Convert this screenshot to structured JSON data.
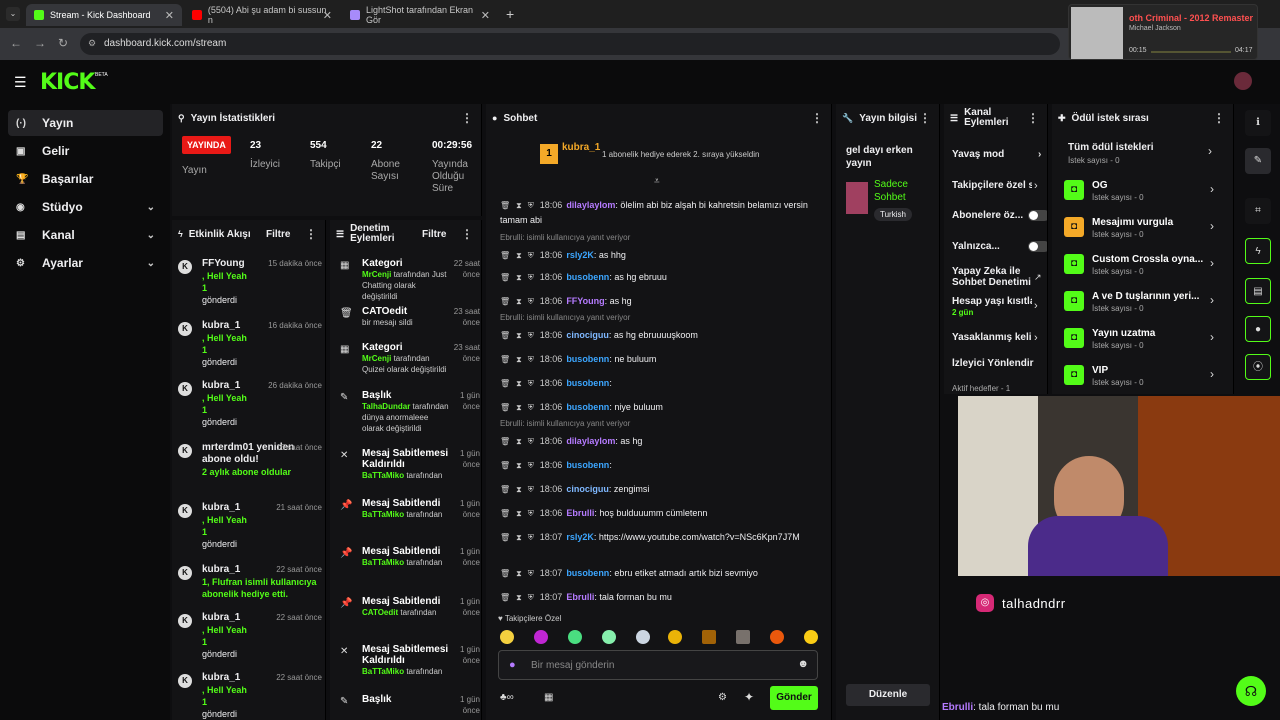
{
  "browser": {
    "tabs": [
      {
        "label": "Stream - Kick Dashboard",
        "color": "#53fc18"
      },
      {
        "label": "(5504) Abi şu adam bi sussun n",
        "color": "#ff0000"
      },
      {
        "label": "LightShot tarafından Ekran Gör",
        "color": "#a78bfa"
      }
    ],
    "url": "dashboard.kick.com/stream",
    "music": {
      "title": "oth Criminal - 2012 Remaster",
      "artist": "Michael Jackson",
      "elapsed": "00:15",
      "total": "04:17"
    }
  },
  "brand": {
    "logo": "KICK",
    "beta": "BETA",
    "accent": "#53fc18"
  },
  "sidebar": {
    "items": [
      {
        "label": "Yayın",
        "icon": "broadcast-icon",
        "glyph": "(·)"
      },
      {
        "label": "Gelir",
        "icon": "wallet-icon",
        "glyph": "▣"
      },
      {
        "label": "Başarılar",
        "icon": "trophy-icon",
        "glyph": "🏆"
      },
      {
        "label": "Stüdyo",
        "icon": "studio-icon",
        "glyph": "◉"
      },
      {
        "label": "Kanal",
        "icon": "channel-icon",
        "glyph": "▤"
      },
      {
        "label": "Ayarlar",
        "icon": "settings-icon",
        "glyph": "⚙"
      }
    ]
  },
  "stats": {
    "title": "Yayın İstatistikleri",
    "live": "YAYINDA",
    "live_label": "Yayın",
    "viewers": "23",
    "viewers_label": "İzleyici",
    "followers": "554",
    "followers_label": "Takipçi",
    "subs": "22",
    "subs_label": "Abone Sayısı",
    "uptime": "00:29:56",
    "uptime_label": "Yayında Olduğu Süre"
  },
  "activity": {
    "title": "Etkinlik Akışı",
    "filter": "Filtre",
    "events": [
      {
        "name": "FFYoung",
        "line2": ", Hell Yeah",
        "line3": "1",
        "line4": "gönderdi",
        "time": "15 dakika önce"
      },
      {
        "name": "kubra_1",
        "line2": ", Hell Yeah",
        "line3": "1",
        "line4": "gönderdi",
        "time": "16 dakika önce"
      },
      {
        "name": "kubra_1",
        "line2": ", Hell Yeah",
        "line3": "1",
        "line4": "gönderdi",
        "time": "26 dakika önce"
      },
      {
        "name": "mrterdm01 yeniden abone oldu!",
        "line2": "2 aylık abone oldular",
        "line3": "",
        "line4": "",
        "time": "15 saat önce"
      },
      {
        "name": "kubra_1",
        "line2": ", Hell Yeah",
        "line3": "1",
        "line4": "gönderdi",
        "time": "21 saat önce"
      },
      {
        "name": "kubra_1",
        "line2": "1, Flufran isimli kullanıcıya abonelik hediye etti.",
        "line3": "",
        "line4": "",
        "time": "22 saat önce"
      },
      {
        "name": "kubra_1",
        "line2": ", Hell Yeah",
        "line3": "1",
        "line4": "gönderdi",
        "time": "22 saat önce"
      },
      {
        "name": "kubra_1",
        "line2": ", Hell Yeah",
        "line3": "1",
        "line4": "gönderdi",
        "time": "22 saat önce"
      }
    ]
  },
  "moderation": {
    "title": "Denetim Eylemleri",
    "filter": "Filtre",
    "items": [
      {
        "title": "Kategori",
        "who": "MrCenji",
        "text": "tarafından Just Chatting olarak değiştirildi",
        "time": "22 saat önce",
        "glyph": "▦"
      },
      {
        "title": "CATOedit",
        "who": "",
        "text": "bir mesajı sildi",
        "time": "23 saat önce",
        "glyph": "🗑"
      },
      {
        "title": "Kategori",
        "who": "MrCenji",
        "text": "tarafından Quizei olarak değiştirildi",
        "time": "23 saat önce",
        "glyph": "▦"
      },
      {
        "title": "Başlık",
        "who": "TalhaDundar",
        "text": "tarafından dünya anormaleee olarak değiştirildi",
        "time": "1 gün önce",
        "glyph": "✎"
      },
      {
        "title": "Mesaj Sabitlemesi Kaldırıldı",
        "who": "BaTTaMiko",
        "text": "tarafından",
        "time": "1 gün önce",
        "glyph": "✕"
      },
      {
        "title": "Mesaj Sabitlendi",
        "who": "BaTTaMiko",
        "text": "tarafından",
        "time": "1 gün önce",
        "glyph": "📌"
      },
      {
        "title": "Mesaj Sabitlendi",
        "who": "BaTTaMiko",
        "text": "tarafından",
        "time": "1 gün önce",
        "glyph": "📌"
      },
      {
        "title": "Mesaj Sabitlendi",
        "who": "CATOedit",
        "text": "tarafından",
        "time": "1 gün önce",
        "glyph": "📌"
      },
      {
        "title": "Mesaj Sabitlemesi Kaldırıldı",
        "who": "BaTTaMiko",
        "text": "tarafından",
        "time": "1 gün önce",
        "glyph": "✕"
      },
      {
        "title": "Başlık",
        "who": "",
        "text": "",
        "time": "1 gün önce",
        "glyph": "✎"
      }
    ]
  },
  "chat": {
    "title": "Sohbet",
    "pinned_user": "kubra_1",
    "pinned_count": "1",
    "pinned_text": "1 abonelik hediye ederek 2. sıraya yükseldin",
    "lines": [
      {
        "time": "18:06",
        "user": "dilaylaylom",
        "color": "#b57bff",
        "text": ": ölelim abi biz alşah bi kahretsin belamızı versin tamam abi",
        "reply": ""
      },
      {
        "time": "18:06",
        "user": "rsly2K",
        "color": "#3ca6ff",
        "text": ": as hhg",
        "reply": "Ebrulli: isimli kullanıcıya yanıt veriyor"
      },
      {
        "time": "18:06",
        "user": "busobenn",
        "color": "#3ca6ff",
        "text": ": as hg ebruuu",
        "reply": ""
      },
      {
        "time": "18:06",
        "user": "FFYoung",
        "color": "#b57bff",
        "text": ": as hg",
        "reply": ""
      },
      {
        "time": "18:06",
        "user": "cinociguu",
        "color": "#7fb8ff",
        "text": ": as hg ebruuuuşkoom",
        "reply": "Ebrulli: isimli kullanıcıya yanıt veriyor"
      },
      {
        "time": "18:06",
        "user": "busobenn",
        "color": "#3ca6ff",
        "text": ": ne buluum",
        "reply": ""
      },
      {
        "time": "18:06",
        "user": "busobenn",
        "color": "#3ca6ff",
        "text": ":",
        "reply": ""
      },
      {
        "time": "18:06",
        "user": "busobenn",
        "color": "#3ca6ff",
        "text": ": niye buluum",
        "reply": ""
      },
      {
        "time": "18:06",
        "user": "dilaylaylom",
        "color": "#b57bff",
        "text": ": as hg",
        "reply": "Ebrulli: isimli kullanıcıya yanıt veriyor"
      },
      {
        "time": "18:06",
        "user": "busobenn",
        "color": "#3ca6ff",
        "text": ":",
        "reply": ""
      },
      {
        "time": "18:06",
        "user": "cinociguu",
        "color": "#7fb8ff",
        "text": ": zengimsi",
        "reply": ""
      },
      {
        "time": "18:06",
        "user": "Ebrulli",
        "color": "#b57bff",
        "text": ": hoş bulduuumm cümletenn",
        "reply": ""
      },
      {
        "time": "18:07",
        "user": "rsly2K",
        "color": "#3ca6ff",
        "text": ": https://www.youtube.com/watch?v=NSc6Kpn7J7M",
        "reply": ""
      },
      {
        "time": "18:07",
        "user": "busobenn",
        "color": "#3ca6ff",
        "text": ": ebru etiket atmadı artık bizi sevmiyo",
        "reply": ""
      },
      {
        "time": "18:07",
        "user": "Ebrulli",
        "color": "#b57bff",
        "text": ": tala forman bu mu",
        "reply": ""
      }
    ],
    "followers_only": "Takipçilere Özel",
    "placeholder": "Bir mesaj gönderin",
    "send": "Gönder"
  },
  "stream_info": {
    "title": "Yayın bilgisi",
    "stream_title": "gel dayı erken yayın",
    "category": "Sadece Sohbet",
    "tag": "Turkish",
    "edit": "Düzenle"
  },
  "channel_actions": {
    "title": "Kanal Eylemleri",
    "items": [
      {
        "label": "Yavaş mod",
        "type": "arrow"
      },
      {
        "label": "Takipçilere özel s",
        "type": "arrow"
      },
      {
        "label": "Abonelere öz...",
        "type": "toggle"
      },
      {
        "label": "Yalnızca...",
        "type": "toggle"
      },
      {
        "label": "Yapay Zeka ile Sohbet Denetimi",
        "type": "link"
      },
      {
        "label": "Hesap yaşı kısıtla",
        "type": "arrow",
        "sub": "2 gün"
      },
      {
        "label": "Yasaklanmış keli",
        "type": "arrow"
      },
      {
        "label": "İzleyici Yönlendir",
        "type": "none"
      },
      {
        "label": "Aktif hedefler - 1",
        "type": "arrow"
      }
    ]
  },
  "rewards": {
    "title": "Ödül istek sırası",
    "all": "Tüm ödül istekleri",
    "all_count": "İstek sayısı - 0",
    "items": [
      {
        "label": "OG",
        "count": "İstek sayısı - 0",
        "color": "green"
      },
      {
        "label": "Mesajımı vurgula",
        "count": "İstek sayısı - 0",
        "color": "orange"
      },
      {
        "label": "Custom Crossla oyna...",
        "count": "İstek sayısı - 0",
        "color": "green"
      },
      {
        "label": "A ve D tuşlarının yeri...",
        "count": "İstek sayısı - 0",
        "color": "green"
      },
      {
        "label": "Yayın uzatma",
        "count": "İstek sayısı - 0",
        "color": "green"
      },
      {
        "label": "VIP",
        "count": "İstek sayısı - 0",
        "color": "green"
      }
    ]
  },
  "overlay": {
    "instagram": "talhadndrr",
    "bottom_user": "Ebrulli",
    "bottom_text": ": tala forman bu mu"
  }
}
